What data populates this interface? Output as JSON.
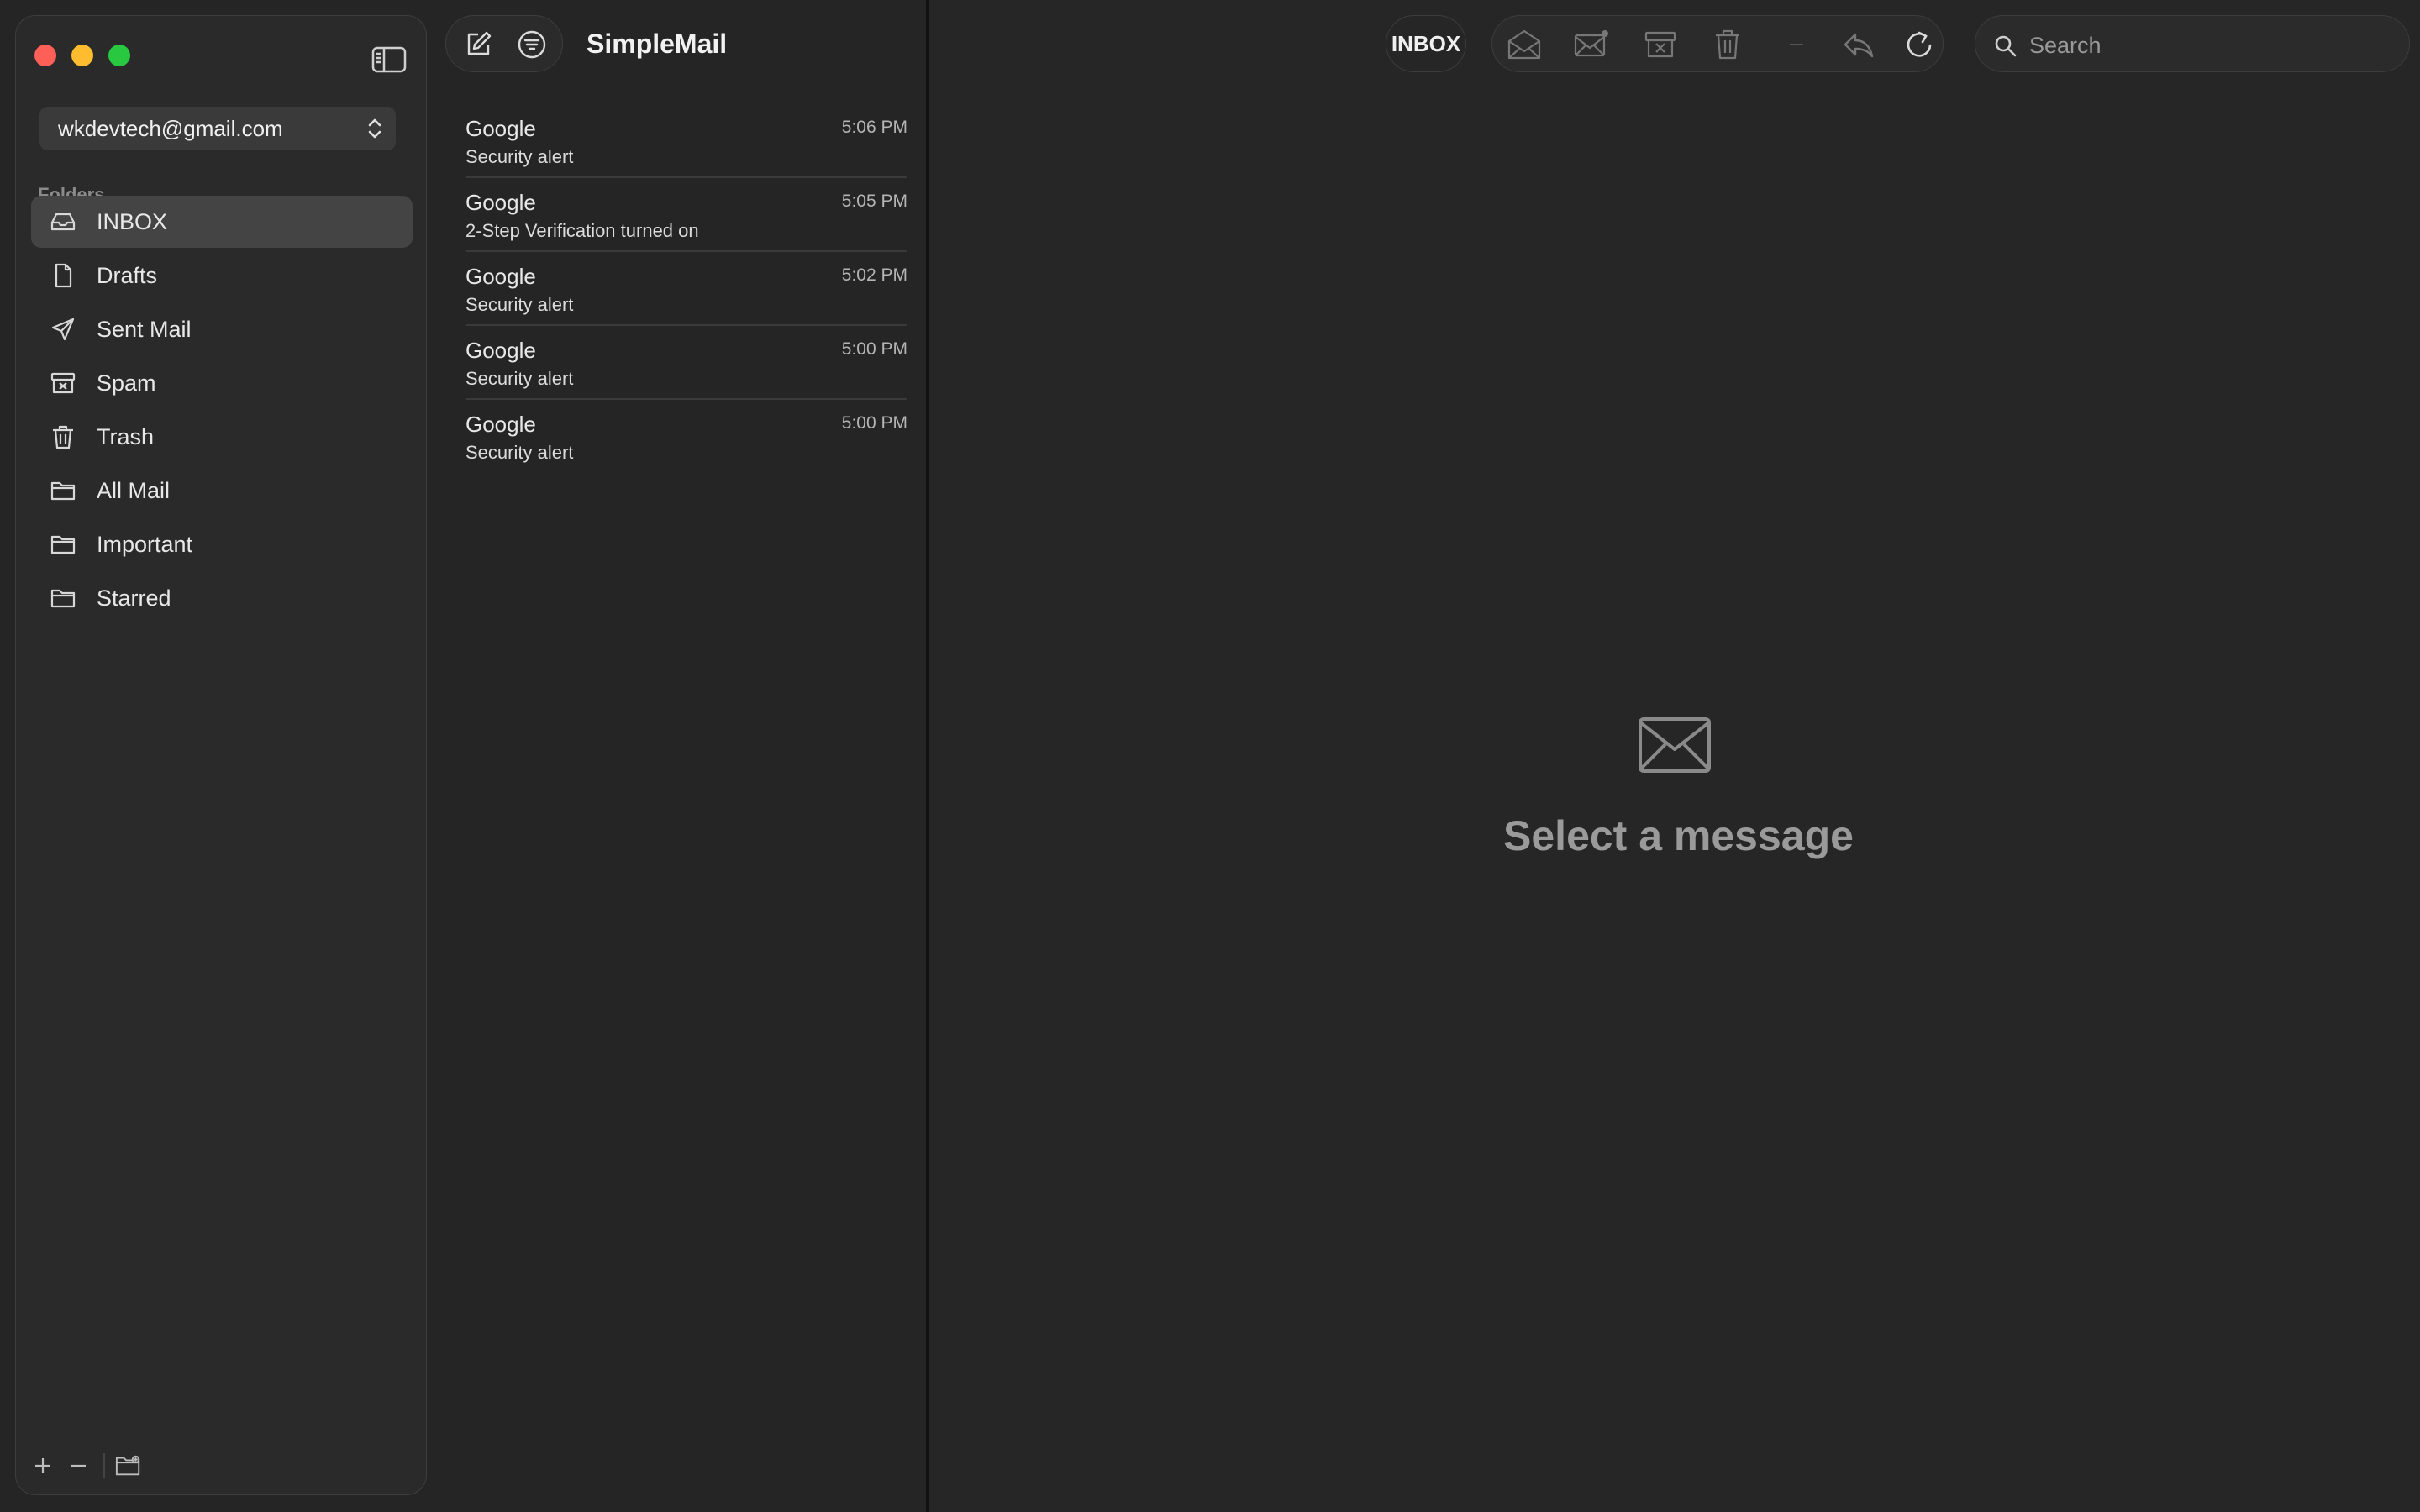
{
  "app": {
    "title": "SimpleMail"
  },
  "account": {
    "email": "wkdevtech@gmail.com"
  },
  "sidebar": {
    "folders_label": "Folders",
    "folders": [
      {
        "label": "INBOX",
        "icon": "tray-icon",
        "active": true
      },
      {
        "label": "Drafts",
        "icon": "document-icon"
      },
      {
        "label": "Sent Mail",
        "icon": "paperplane-icon"
      },
      {
        "label": "Spam",
        "icon": "spam-box-icon"
      },
      {
        "label": "Trash",
        "icon": "trash-icon"
      },
      {
        "label": "All Mail",
        "icon": "folder-icon"
      },
      {
        "label": "Important",
        "icon": "folder-icon"
      },
      {
        "label": "Starred",
        "icon": "folder-icon"
      }
    ]
  },
  "messages": [
    {
      "from": "Google",
      "subject": "Security alert",
      "time": "5:06 PM"
    },
    {
      "from": "Google",
      "subject": "2-Step Verification turned on",
      "time": "5:05 PM"
    },
    {
      "from": "Google",
      "subject": "Security alert",
      "time": "5:02 PM"
    },
    {
      "from": "Google",
      "subject": "Security alert",
      "time": "5:00 PM"
    },
    {
      "from": "Google",
      "subject": "Security alert",
      "time": "5:00 PM"
    }
  ],
  "detail": {
    "current_folder": "INBOX",
    "empty_text": "Select a message"
  },
  "search": {
    "placeholder": "Search"
  },
  "colors": {
    "window_bg": "#252525",
    "sidebar_bg": "#2a2a2a",
    "active_row": "#444444",
    "traffic_red": "#fe5f57",
    "traffic_yellow": "#febc2e",
    "traffic_green": "#28c840"
  }
}
